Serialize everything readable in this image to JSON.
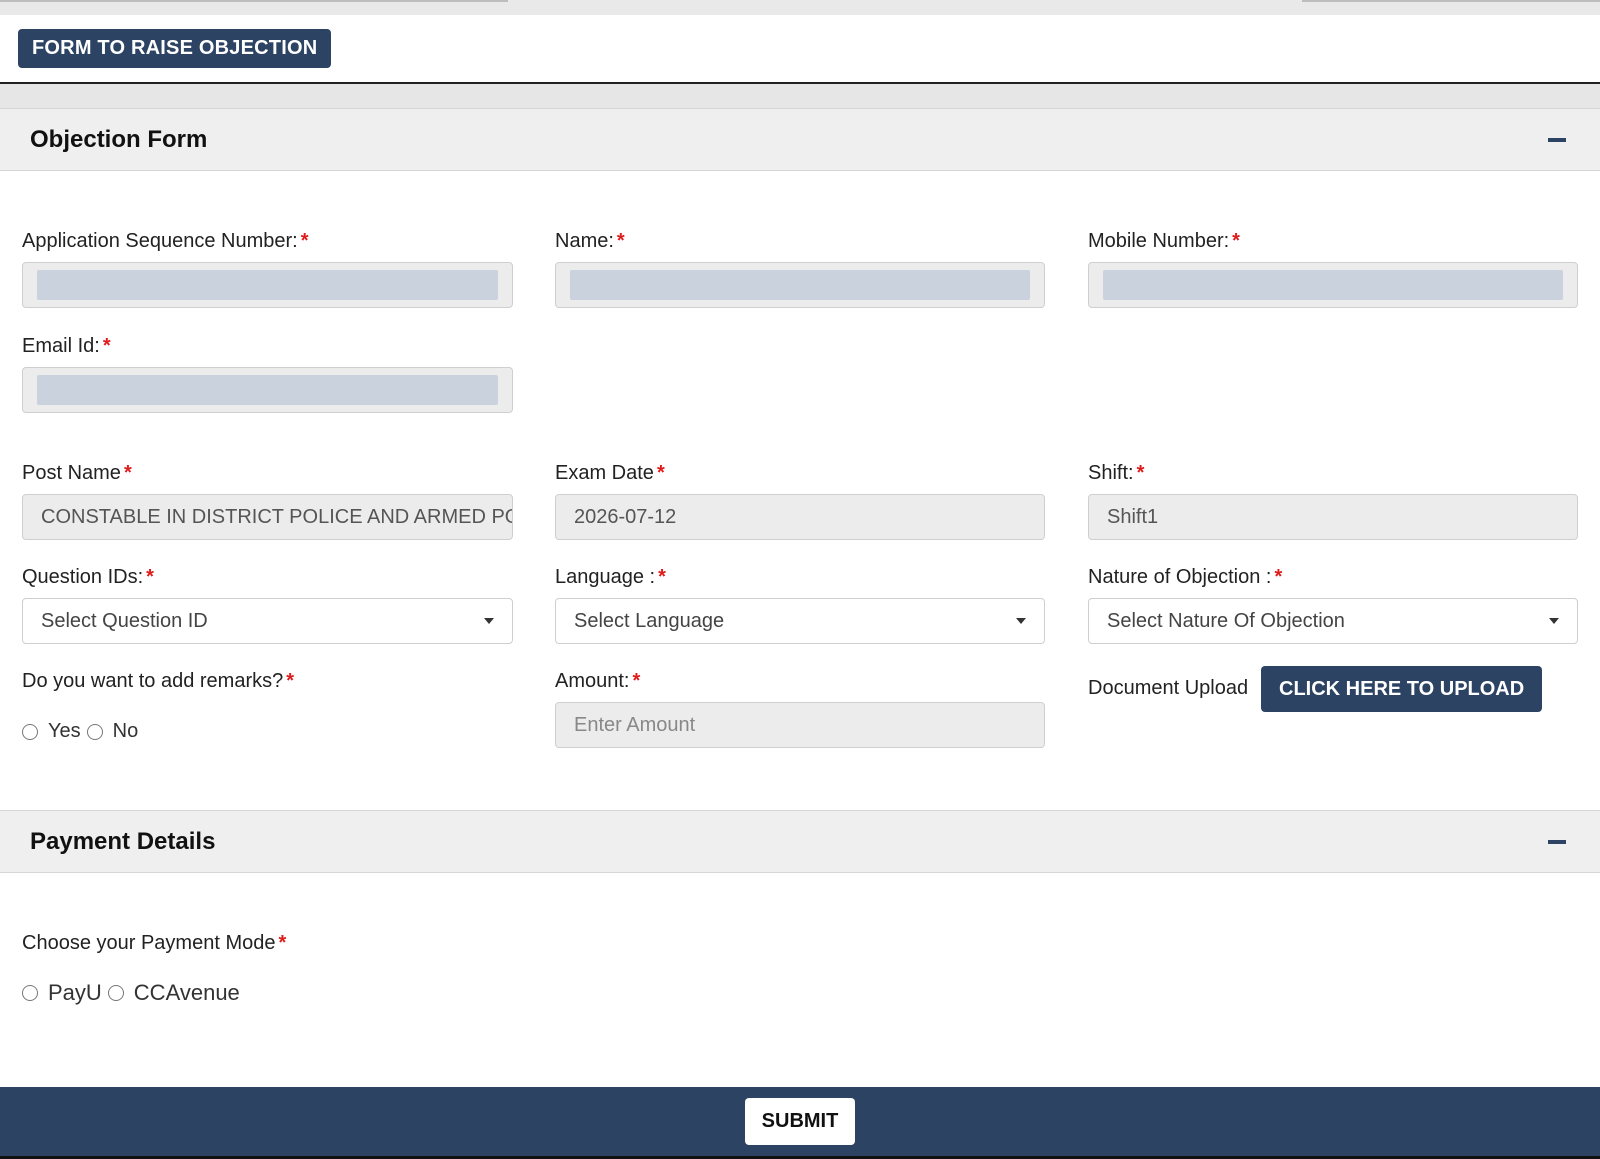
{
  "header": {
    "title_button": "FORM TO RAISE OBJECTION"
  },
  "objection_panel": {
    "title": "Objection Form",
    "fields": {
      "application_sequence_number": {
        "label": "Application Sequence Number:",
        "required": "*",
        "value": ""
      },
      "name": {
        "label": "Name:",
        "required": "*",
        "value": ""
      },
      "mobile_number": {
        "label": "Mobile Number:",
        "required": "*",
        "value": ""
      },
      "email_id": {
        "label": "Email Id:",
        "required": "*",
        "value": ""
      },
      "post_name": {
        "label": "Post Name",
        "required": "*",
        "value": "CONSTABLE IN DISTRICT POLICE AND ARMED POL"
      },
      "exam_date": {
        "label": "Exam Date",
        "required": "*",
        "value": "2026-07-12"
      },
      "shift": {
        "label": "Shift:",
        "required": "*",
        "value": "Shift1"
      },
      "question_ids": {
        "label": "Question IDs:",
        "required": "*",
        "selected": "Select Question ID"
      },
      "language": {
        "label": "Language :",
        "required": "*",
        "selected": "Select Language"
      },
      "nature_of_objection": {
        "label": "Nature of Objection :",
        "required": "*",
        "selected": "Select Nature Of Objection"
      },
      "remarks": {
        "label": "Do you want to add remarks?",
        "required": "*",
        "options": [
          "Yes",
          "No"
        ]
      },
      "amount": {
        "label": "Amount:",
        "required": "*",
        "placeholder": "Enter Amount"
      },
      "document_upload": {
        "label": "Document Upload",
        "button": "CLICK HERE TO UPLOAD"
      }
    }
  },
  "payment_panel": {
    "title": "Payment Details",
    "mode_label": "Choose your Payment Mode",
    "required": "*",
    "options": [
      "PayU",
      "CCAvenue"
    ]
  },
  "footer": {
    "submit_label": "SUBMIT"
  },
  "colors": {
    "brand": "#2c4364",
    "required": "#e01b1b",
    "panel_header_bg": "#efefef",
    "input_bg": "#ececec",
    "masked_value": "#c9d2dd"
  },
  "icons": {
    "collapse": "minus-icon",
    "dropdown": "caret-down-icon"
  }
}
